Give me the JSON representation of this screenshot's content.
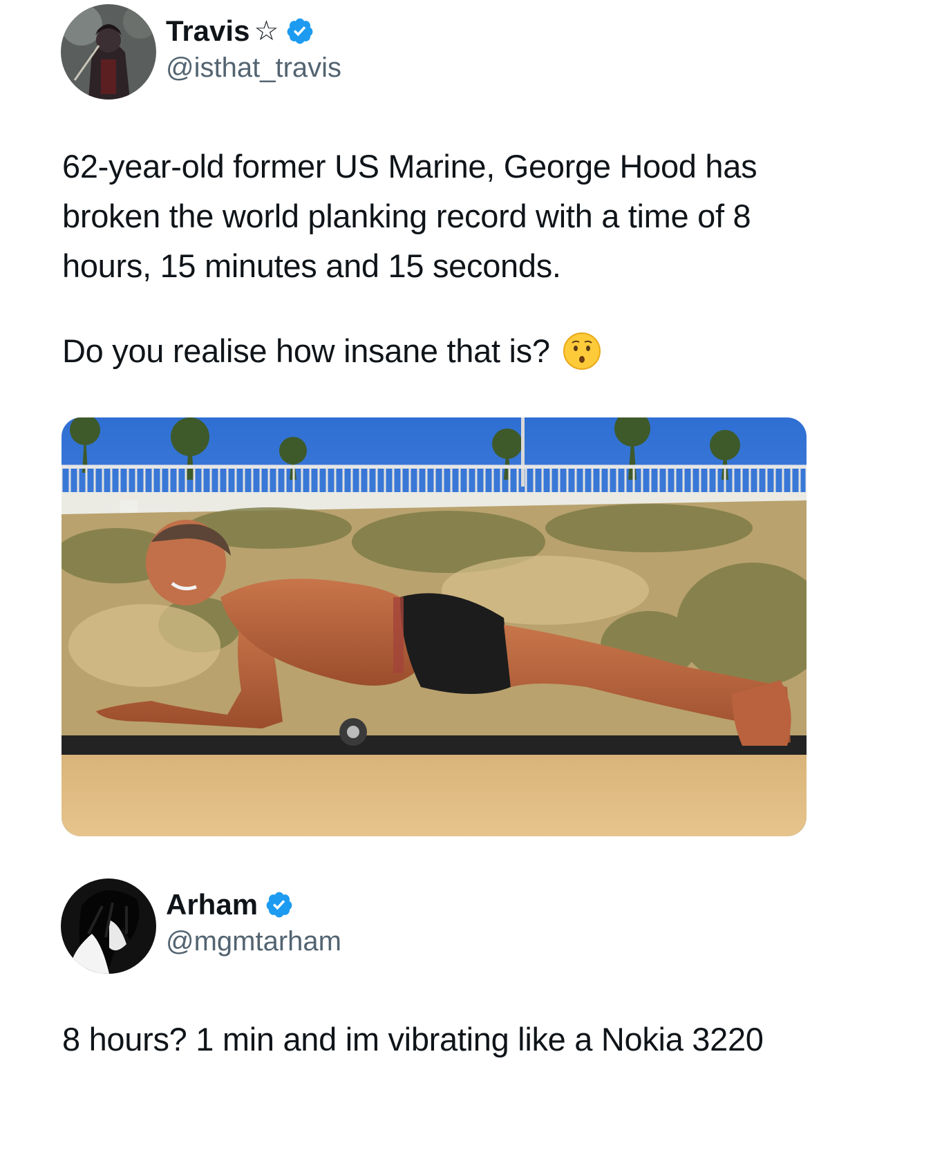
{
  "post1": {
    "display_name": "Travis",
    "name_suffix": "☆",
    "handle": "@isthat_travis",
    "paragraph1": "62-year-old former US Marine, George Hood has broken the world planking record with a time of 8 hours, 15 minutes and 15 seconds.",
    "paragraph2": "Do you realise how insane that is?",
    "emoji_icon": "hushed-face-icon",
    "avatar_icon": "anime-character-avatar",
    "media_icon": "man-planking-on-beach-photo"
  },
  "post2": {
    "display_name": "Arham",
    "handle": "@mgmtarham",
    "text": "8 hours? 1 min and im vibrating like a Nokia 3220",
    "avatar_icon": "anime-character-avatar-bw"
  },
  "colors": {
    "verified_blue": "#1d9bf0",
    "handle_gray": "#536471",
    "text": "#0f1419"
  }
}
